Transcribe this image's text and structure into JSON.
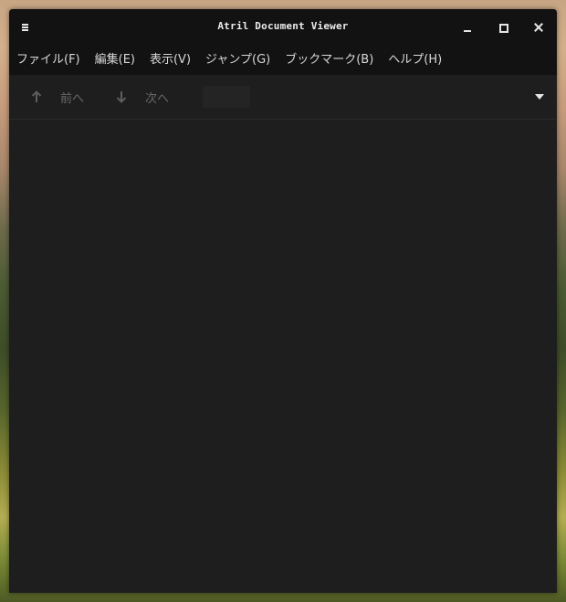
{
  "window": {
    "title": "Atril Document Viewer"
  },
  "menubar": {
    "items": [
      {
        "label": "ファイル(F)"
      },
      {
        "label": "編集(E)"
      },
      {
        "label": "表示(V)"
      },
      {
        "label": "ジャンプ(G)"
      },
      {
        "label": "ブックマーク(B)"
      },
      {
        "label": "ヘルプ(H)"
      }
    ]
  },
  "toolbar": {
    "prev_label": "前へ",
    "next_label": "次へ",
    "page_value": ""
  },
  "icons": {
    "menu": "hamburger-icon",
    "minimize": "minimize-icon",
    "maximize": "maximize-icon",
    "close": "close-icon",
    "prev": "arrow-up-icon",
    "next": "arrow-down-icon",
    "dropdown": "triangle-down-icon"
  },
  "colors": {
    "titlebar": "#121212",
    "window_bg": "#1e1e1e",
    "text": "#d8d8d8",
    "disabled_text": "#6a6a6a"
  }
}
